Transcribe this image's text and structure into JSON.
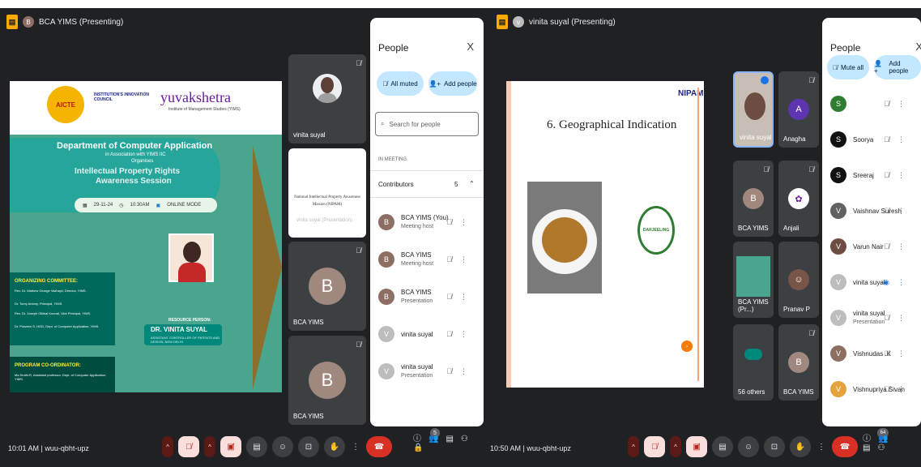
{
  "left": {
    "title": "BCA YIMS (Presenting)",
    "poster": {
      "logo_left": "AICTE",
      "logo_mid": "INSTITUTION'S INNOVATION COUNCIL",
      "brand": "yuvakshetra",
      "brand_sub": "Institute of Management Studies (YIMS)",
      "dept": "Department of Computer Application",
      "assoc": "in Association with YIMS IIC",
      "organises": "Organises",
      "event1": "Intellectual Property Rights",
      "event2": "Awareness Session",
      "date": "29-11-24",
      "time": "10:30AM",
      "mode": "ONLINE MODE",
      "committee_title": "ORGANIZING COMMITTEE:",
      "committee": [
        "Rev. Dr. Mathew George Vazhayil, Director, YIMS.",
        "Dr. Tomy Antony, Principal, YIMS.",
        "Rev. Dr. Joseph Olikkal Koonal, Vice Principal, YIMS.",
        "Dr. Praveen S. HOD, Dept. of Computer Application, YIMS."
      ],
      "coord_title": "PROGRAM CO-ORDINATOR:",
      "coord": "Ms.Sruthi.R, Assistant professor, Dept. of Computer Application, YIMS.",
      "resource": "RESOURCE PERSON:",
      "speaker": "DR. VINITA SUYAL",
      "speaker_sub": "ASSISTANT CONTROLLER OF PATENTS AND DESIGN, NEW DELHI."
    },
    "tiles": [
      {
        "name": "vinita suyal"
      },
      {
        "name": "vinita suyal (Presentation)",
        "slide_text": "National Intellectual Property Awareness Mission (NIPAM)"
      },
      {
        "name": "BCA YIMS",
        "initial": "B"
      },
      {
        "name": "BCA YIMS",
        "initial": "B"
      }
    ],
    "panel": {
      "title": "People",
      "close": "X",
      "all_muted": "All muted",
      "add_people": "Add people",
      "search_placeholder": "Search for people",
      "in_meeting": "IN MEETING",
      "contributors": "Contributors",
      "contributors_count": "5",
      "people": [
        {
          "name": "BCA YIMS (You)",
          "role": "Meeting host",
          "initial": "B"
        },
        {
          "name": "BCA YIMS",
          "role": "Meeting host",
          "initial": "B"
        },
        {
          "name": "BCA YIMS",
          "role": "Presentation",
          "initial": "B"
        },
        {
          "name": "vinita suyal",
          "role": "",
          "initial": "V"
        },
        {
          "name": "vinita suyal",
          "role": "Presentation",
          "initial": "V"
        }
      ]
    },
    "clock": "10:01 AM",
    "code": "wuu-qbht-upz",
    "badge_count": "5"
  },
  "right": {
    "title": "vinita suyal (Presenting)",
    "slide_heading": "6. Geographical Indication",
    "slide_logo": "NIPAM",
    "slide_emblem": "DARJEELING",
    "tiles": [
      {
        "name": "vinita suyal"
      },
      {
        "name": "Anagha",
        "initial": "A"
      },
      {
        "name": "BCA YIMS",
        "initial": "B"
      },
      {
        "name": "Anjali"
      },
      {
        "name": "BCA YIMS (Pr...)"
      },
      {
        "name": "Pranav P"
      },
      {
        "name": "56 others"
      },
      {
        "name": "BCA YIMS",
        "initial": "B"
      }
    ],
    "panel": {
      "title": "People",
      "close": "X",
      "mute_all": "Mute all",
      "add_people": "Add people",
      "people": [
        {
          "name": "",
          "role": "",
          "initial": "S"
        },
        {
          "name": "Soorya",
          "role": "",
          "initial": "S"
        },
        {
          "name": "Sreeraj",
          "role": "",
          "initial": "S"
        },
        {
          "name": "Vaishnav Suresh",
          "role": "",
          "initial": "V"
        },
        {
          "name": "Varun Nair",
          "role": "",
          "initial": "V"
        },
        {
          "name": "vinita suyal",
          "role": "",
          "initial": "V"
        },
        {
          "name": "vinita suyal",
          "role": "Presentation",
          "initial": "V"
        },
        {
          "name": "Vishnudas .K",
          "role": "",
          "initial": "V"
        },
        {
          "name": "Vishnupriya Sivan",
          "role": "",
          "initial": "V"
        }
      ]
    },
    "clock": "10:50 AM",
    "code": "wuu-qbht-upz",
    "badge_count": "64"
  },
  "colors": {
    "meet_bg": "#202124",
    "tile": "#3c4043",
    "accent": "#c2e7ff",
    "end_call": "#d93025"
  }
}
